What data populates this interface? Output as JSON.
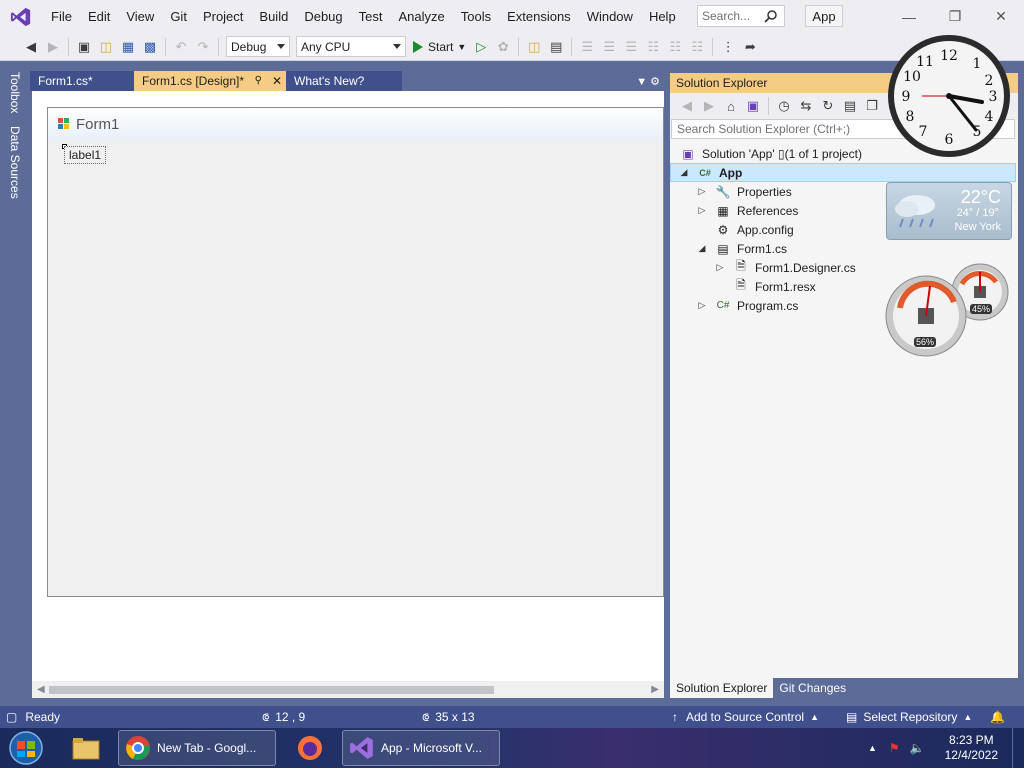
{
  "menu": {
    "items": [
      "File",
      "Edit",
      "View",
      "Git",
      "Project",
      "Build",
      "Debug",
      "Test",
      "Analyze",
      "Tools",
      "Extensions",
      "Window",
      "Help"
    ],
    "search_placeholder": "Search...",
    "app_badge": "App"
  },
  "toolbar": {
    "config": "Debug",
    "platform": "Any CPU",
    "start_label": "Start"
  },
  "side_tabs": [
    "Toolbox",
    "Data Sources"
  ],
  "doc_tabs": [
    {
      "label": "Form1.cs*"
    },
    {
      "label": "Form1.cs [Design]*"
    },
    {
      "label": "What's New?"
    }
  ],
  "designer": {
    "form_title": "Form1",
    "label_text": "label1"
  },
  "solution_explorer": {
    "title": "Solution Explorer",
    "search_placeholder": "Search Solution Explorer (Ctrl+;)",
    "solution_label": "Solution 'App' ▯(1 of 1 project)",
    "project": "App",
    "items": [
      "Properties",
      "References",
      "App.config",
      "Form1.cs",
      "Form1.Designer.cs",
      "Form1.resx",
      "Program.cs"
    ],
    "bottom_tabs": [
      "Solution Explorer",
      "Git Changes"
    ]
  },
  "gadgets": {
    "weather_temp": "22°C",
    "weather_hilo": "24° / 19°",
    "weather_city": "New York",
    "cpu_percent": "56%",
    "mem_percent": "45%"
  },
  "status": {
    "ready": "Ready",
    "position": "12 , 9",
    "size": "35 x 13",
    "source_control": "Add to Source Control",
    "repository": "Select Repository"
  },
  "taskbar": {
    "chrome": "New Tab - Googl...",
    "vs": "App - Microsoft V...",
    "time": "8:23 PM",
    "date": "12/4/2022"
  }
}
